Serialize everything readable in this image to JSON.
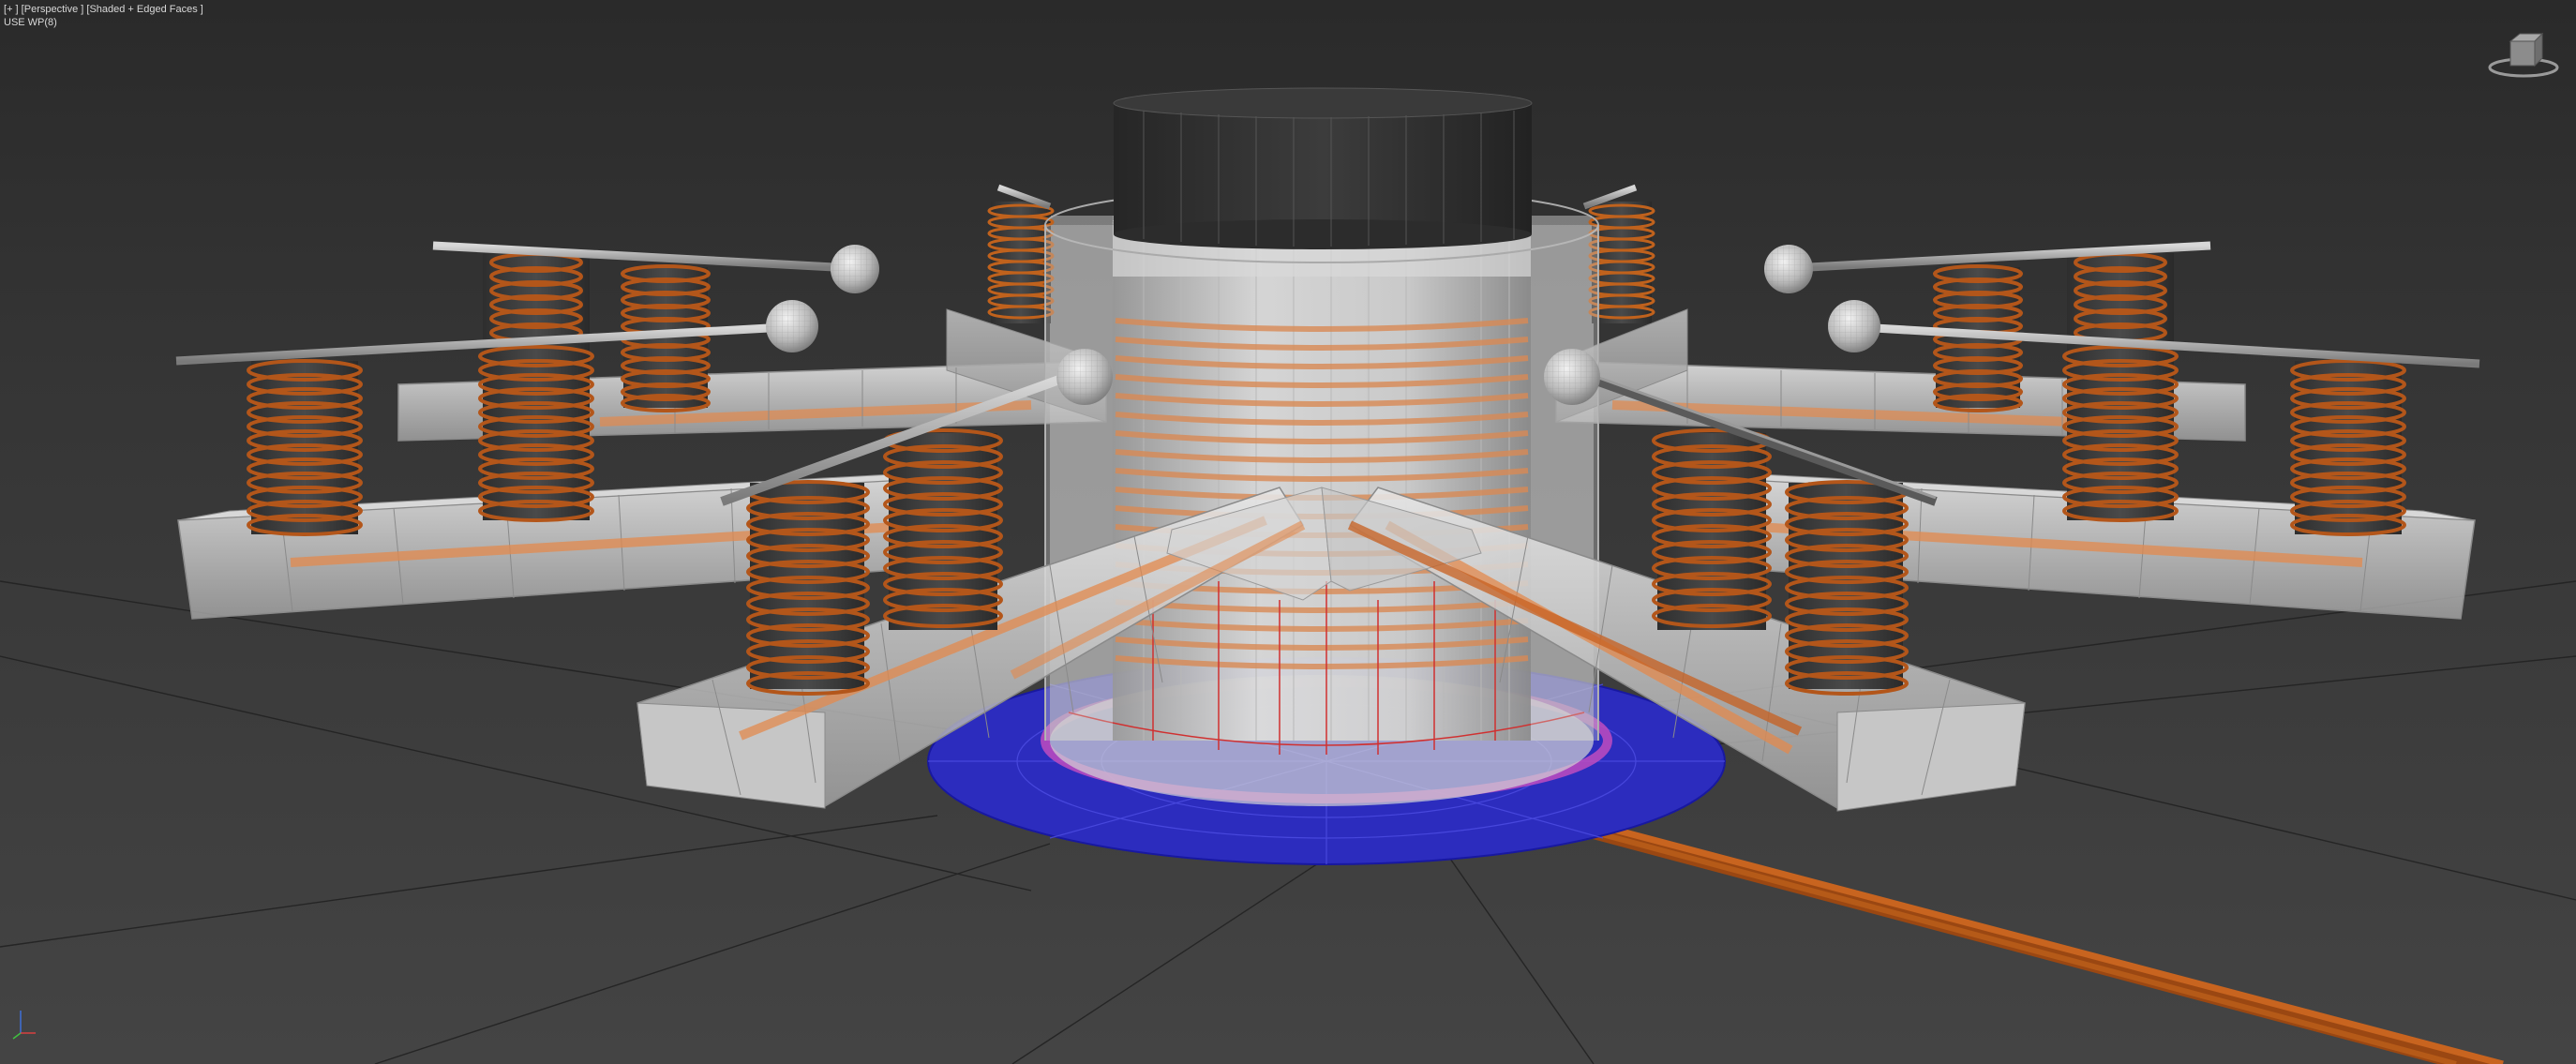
{
  "viewport": {
    "menu": {
      "open": "[",
      "plus": "+",
      "sep1": " ] [",
      "view": "Perspective",
      "sep2": " ] [",
      "shading": "Shaded + Edged Faces",
      "close": " ]"
    },
    "work_plane": "USE WP(8)",
    "viewcube_icon": "viewcube-icon",
    "axis_icon": "axis-tripod-icon"
  },
  "colors": {
    "background_top": "#2a2a2a",
    "background_bottom": "#444444",
    "grid": "#202020",
    "copper": "#b8561a",
    "glass": "#c8c8c8",
    "dark_cap": "#353535",
    "base_disc": "#3232c8",
    "magenta_ring": "#c04cc0"
  }
}
